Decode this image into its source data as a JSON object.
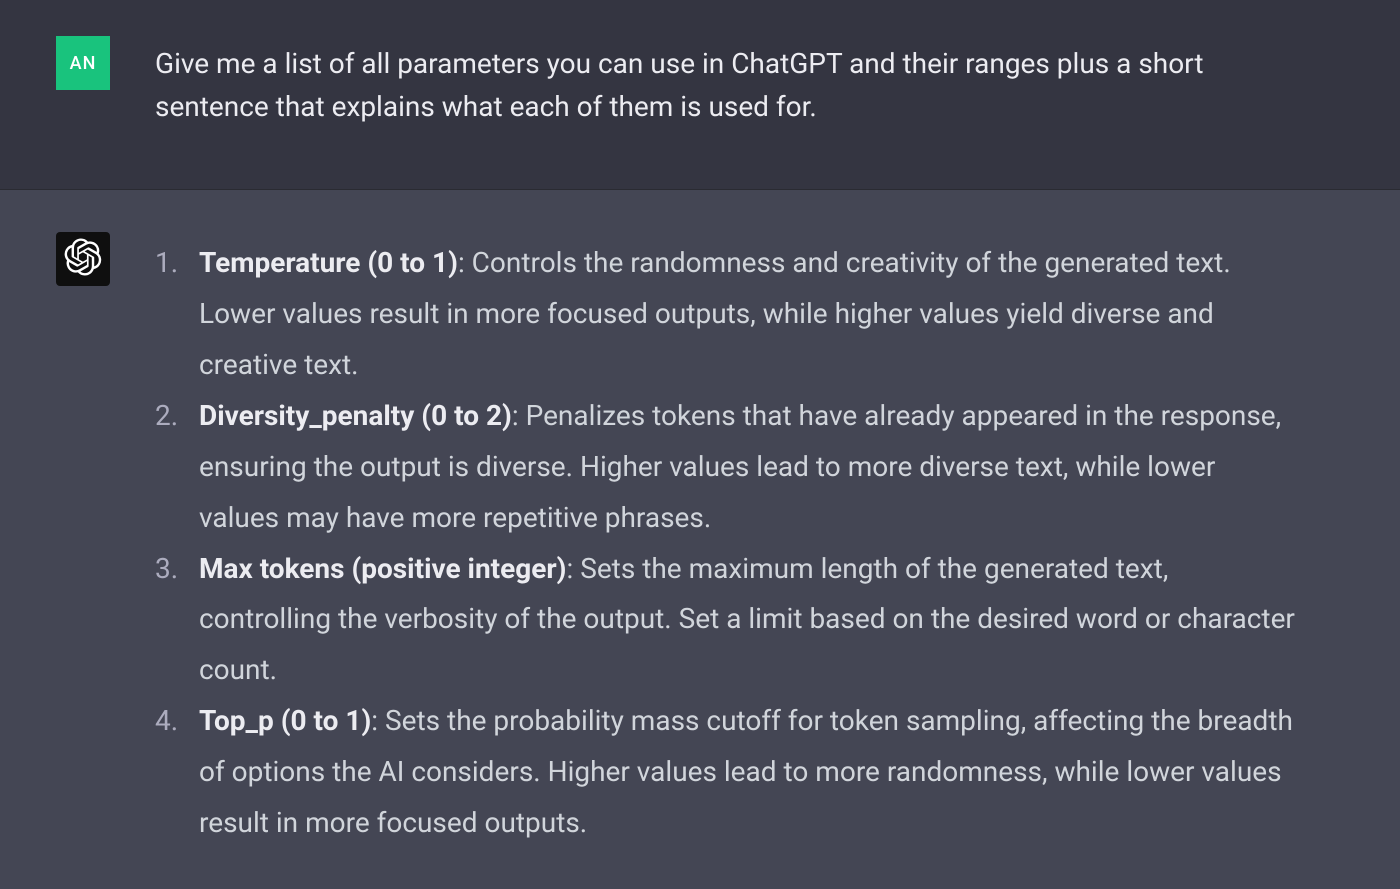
{
  "user": {
    "avatar_initials": "AN",
    "message": "Give me a list of all parameters you can use in ChatGPT and their ranges plus a short sentence that explains what each of them is used for."
  },
  "assistant": {
    "items": [
      {
        "name": "Temperature (0 to 1)",
        "desc": ": Controls the randomness and creativity of the generated text. Lower values result in more focused outputs, while higher values yield diverse and creative text."
      },
      {
        "name": "Diversity_penalty (0 to 2)",
        "desc": ": Penalizes tokens that have already appeared in the response, ensuring the output is diverse. Higher values lead to more diverse text, while lower values may have more repetitive phrases."
      },
      {
        "name": "Max tokens (positive integer)",
        "desc": ": Sets the maximum length of the generated text, controlling the verbosity of the output. Set a limit based on the desired word or character count."
      },
      {
        "name": "Top_p (0 to 1)",
        "desc": ": Sets the probability mass cutoff for token sampling, affecting the breadth of options the AI considers. Higher values lead to more randomness, while lower values result in more focused outputs."
      }
    ]
  }
}
